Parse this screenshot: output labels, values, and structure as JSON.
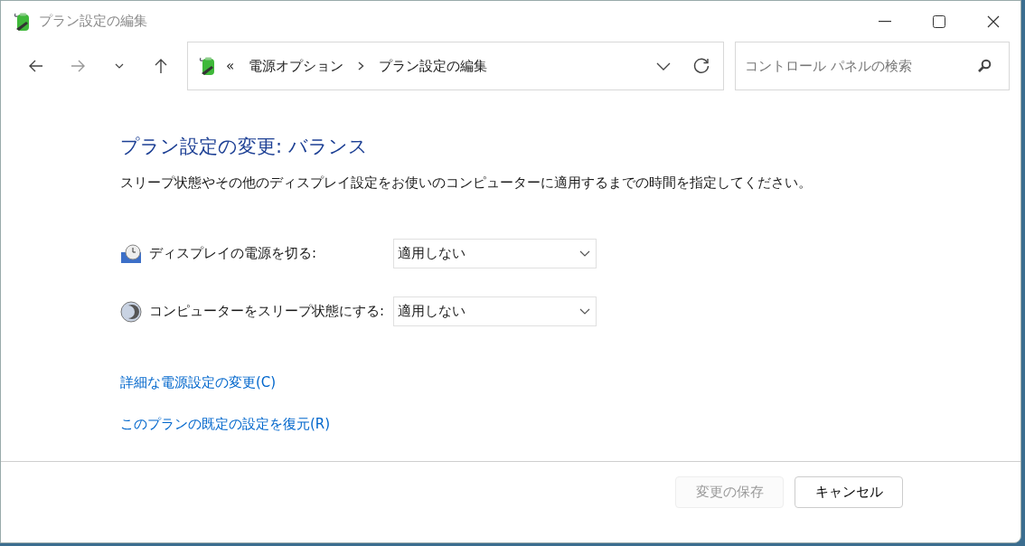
{
  "window": {
    "title": "プラン設定の編集"
  },
  "nav": [
    {
      "kind": "back",
      "disabled": false
    },
    {
      "kind": "forward",
      "disabled": true
    },
    {
      "kind": "recent",
      "disabled": false
    },
    {
      "kind": "up",
      "disabled": false
    }
  ],
  "address": {
    "overflow": "«",
    "crumbs": [
      "電源オプション",
      "プラン設定の編集"
    ]
  },
  "search": {
    "placeholder": "コントロール パネルの検索"
  },
  "heading": "プラン設定の変更: バランス",
  "description": "スリープ状態やその他のディスプレイ設定をお使いのコンピューターに適用するまでの時間を指定してください。",
  "settings": [
    {
      "kind": "display",
      "label": "ディスプレイの電源を切る:",
      "value": "適用しない"
    },
    {
      "kind": "sleep",
      "label": "コンピューターをスリープ状態にする:",
      "value": "適用しない"
    }
  ],
  "links": [
    "詳細な電源設定の変更(C)",
    "このプランの既定の設定を復元(R)"
  ],
  "buttons": [
    {
      "label": "変更の保存",
      "disabled": true
    },
    {
      "label": "キャンセル",
      "disabled": false
    }
  ]
}
